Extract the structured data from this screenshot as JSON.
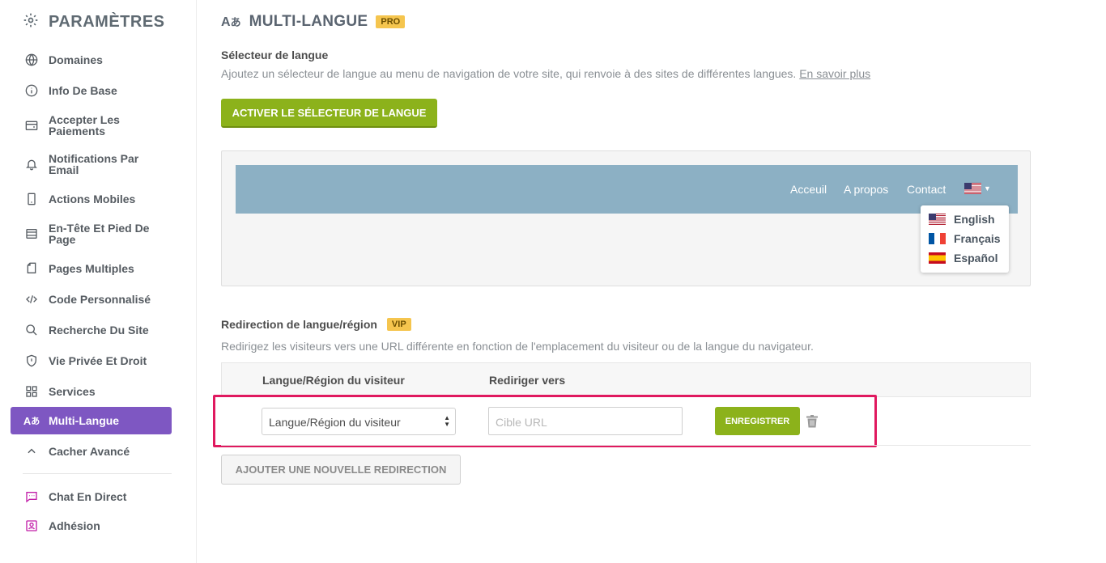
{
  "sidebar": {
    "title": "PARAMÈTRES",
    "items": [
      {
        "label": "Domaines",
        "icon": "globe-icon"
      },
      {
        "label": "Info De Base",
        "icon": "info-icon"
      },
      {
        "label": "Accepter Les Paiements",
        "icon": "wallet-icon"
      },
      {
        "label": "Notifications Par Email",
        "icon": "bell-icon"
      },
      {
        "label": "Actions Mobiles",
        "icon": "mobile-icon"
      },
      {
        "label": "En-Tête Et Pied De Page",
        "icon": "header-footer-icon"
      },
      {
        "label": "Pages Multiples",
        "icon": "pages-icon"
      },
      {
        "label": "Code Personnalisé",
        "icon": "code-icon"
      },
      {
        "label": "Recherche Du Site",
        "icon": "search-icon"
      },
      {
        "label": "Vie Privée Et Droit",
        "icon": "shield-icon"
      },
      {
        "label": "Services",
        "icon": "grid-icon"
      },
      {
        "label": "Multi-Langue",
        "icon": "translate-icon",
        "active": true
      },
      {
        "label": "Cacher Avancé",
        "icon": "chevron-up-icon"
      },
      {
        "label": "Chat En Direct",
        "icon": "chat-icon"
      },
      {
        "label": "Adhésion",
        "icon": "member-icon"
      }
    ]
  },
  "header": {
    "title": "MULTI-LANGUE",
    "badge": "PRO"
  },
  "selector_section": {
    "title": "Sélecteur de langue",
    "description": "Ajoutez un sélecteur de langue au menu de navigation de votre site, qui renvoie à des sites de différentes langues.",
    "learn_more": "En savoir plus",
    "activate_button": "ACTIVER LE SÉLECTEUR DE LANGUE"
  },
  "preview": {
    "nav_links": [
      "Acceuil",
      "A propos",
      "Contact"
    ],
    "languages": [
      "English",
      "Français",
      "Español"
    ]
  },
  "redirect_section": {
    "title": "Redirection de langue/région",
    "badge": "VIP",
    "description": "Redirigez les visiteurs vers une URL différente en fonction de l'emplacement du visiteur ou de la langue du navigateur.",
    "col_visitor": "Langue/Région du visiteur",
    "col_redirect": "Rediriger vers",
    "select_value": "Langue/Région du visiteur",
    "url_placeholder": "Cible URL",
    "save_button": "ENREGISTRER",
    "add_button": "AJOUTER UNE NOUVELLE REDIRECTION"
  },
  "colors": {
    "accent_purple": "#7e57c2",
    "green": "#8cb21b",
    "highlight": "#e0195f",
    "badge": "#f5c54e",
    "navbar": "#8cb0c4"
  }
}
